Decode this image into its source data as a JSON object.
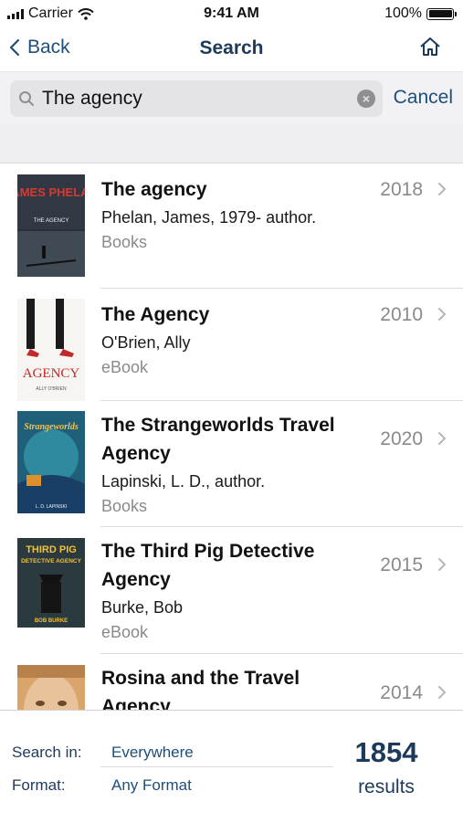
{
  "status_bar": {
    "carrier": "Carrier",
    "time": "9:41 AM",
    "battery": "100%"
  },
  "nav": {
    "back_label": "Back",
    "title": "Search"
  },
  "search": {
    "query": "The agency",
    "cancel_label": "Cancel"
  },
  "results": [
    {
      "title": "The agency",
      "author": "Phelan, James, 1979- author.",
      "format": "Books",
      "year": "2018",
      "cover": {
        "top_text": "JAMES PHELAN",
        "sub_text": "THE AGENCY"
      }
    },
    {
      "title": "The Agency",
      "author": "O'Brien, Ally",
      "format": "eBook",
      "year": "2010",
      "cover": {
        "top_text": "AGENCY",
        "sub_text": "ALLY O'BRIEN"
      }
    },
    {
      "title": "The Strangeworlds Travel Agency",
      "author": "Lapinski, L. D., author.",
      "format": "Books",
      "year": "2020",
      "cover": {
        "top_text": "Strangeworlds",
        "sub_text": "L. D. LAPINSKI"
      }
    },
    {
      "title": "The Third Pig Detective Agency",
      "author": "Burke, Bob",
      "format": "eBook",
      "year": "2015",
      "cover": {
        "top_text": "THIRD PIG",
        "sub_text": "DETECTIVE AGENCY",
        "author_text": "BOB BURKE"
      }
    },
    {
      "title": "Rosina and the Travel Agency",
      "author": "",
      "format": "",
      "year": "2014",
      "cover": {}
    }
  ],
  "footer": {
    "search_in_label": "Search in:",
    "search_in_value": "Everywhere",
    "format_label": "Format:",
    "format_value": "Any Format",
    "count": "1854",
    "count_label": "results"
  },
  "colors": {
    "accent": "#1d4f7c",
    "title_navy": "#1d3a5c",
    "muted": "#8a8a8e"
  }
}
